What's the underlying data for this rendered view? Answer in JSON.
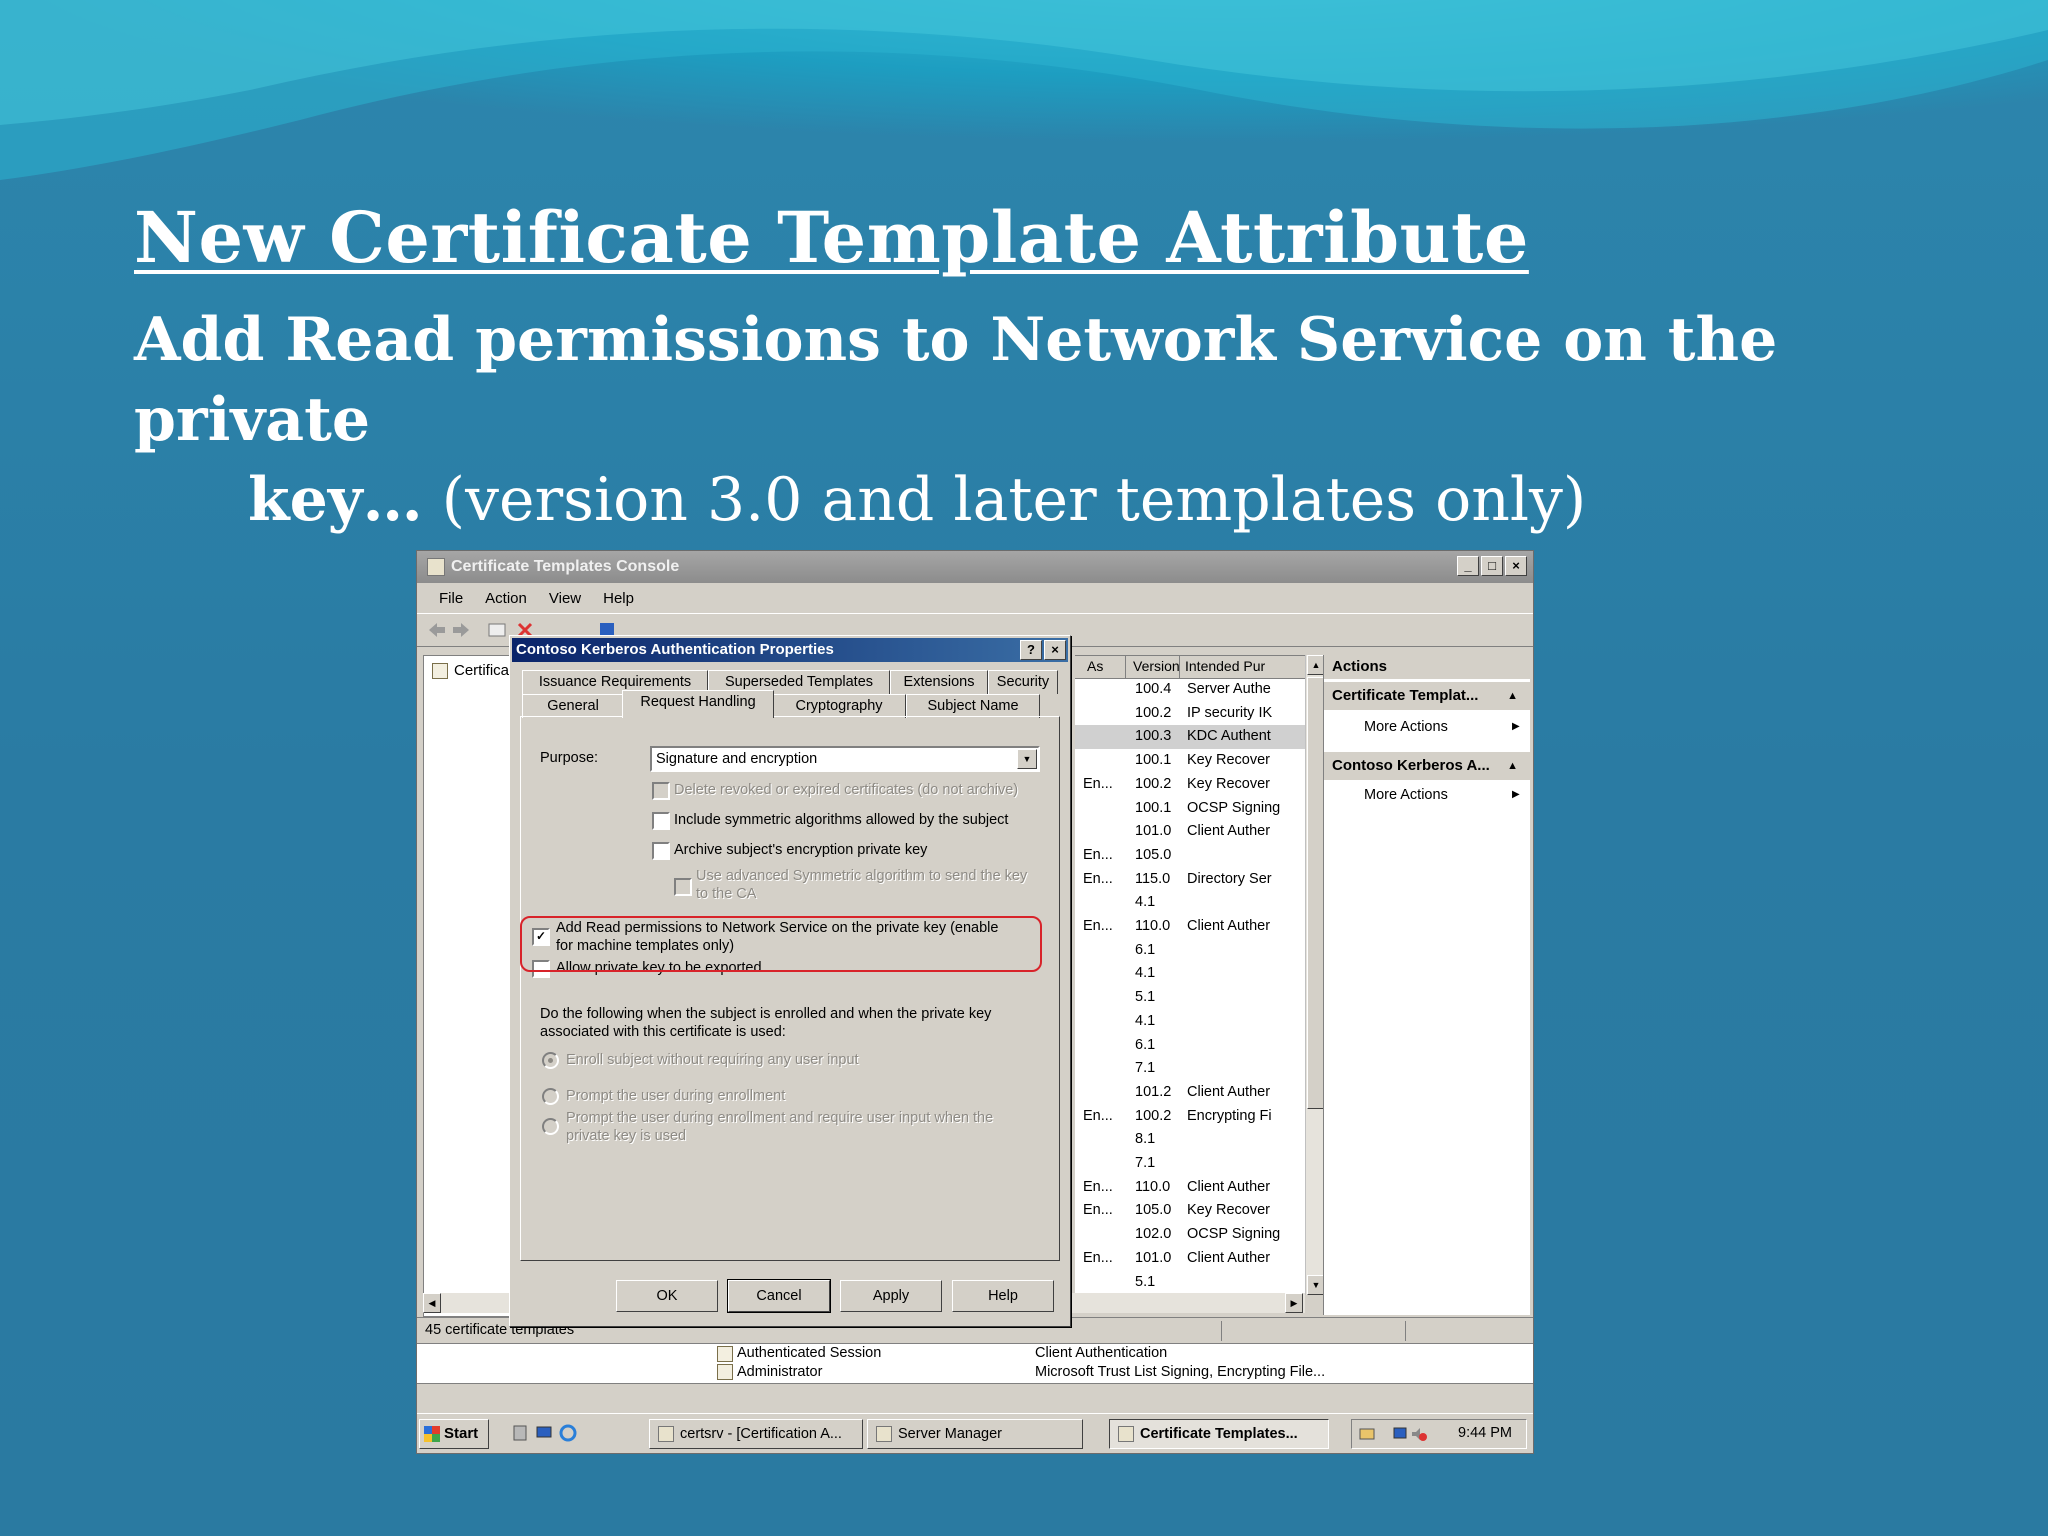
{
  "slide": {
    "title": "New Certificate Template Attribute",
    "subtitle_bold_1": "Add Read permissions to Network Service on the private",
    "subtitle_bold_2": "key…",
    "subtitle_normal": " (version 3.0 and later templates only)"
  },
  "window": {
    "title": "Certificate Templates Console",
    "menu": [
      "File",
      "Action",
      "View",
      "Help"
    ],
    "tree_item": "Certifica"
  },
  "list": {
    "columns": [
      "As",
      "Version",
      "Intended Pur"
    ],
    "rows": [
      {
        "as": "",
        "version": "100.4",
        "purpose": "Server Authe"
      },
      {
        "as": "",
        "version": "100.2",
        "purpose": "IP security IK"
      },
      {
        "as": "",
        "version": "100.3",
        "purpose": "KDC Authent"
      },
      {
        "as": "",
        "version": "100.1",
        "purpose": "Key Recover"
      },
      {
        "as": "En...",
        "version": "100.2",
        "purpose": "Key Recover"
      },
      {
        "as": "",
        "version": "100.1",
        "purpose": "OCSP Signing"
      },
      {
        "as": "",
        "version": "101.0",
        "purpose": "Client Auther"
      },
      {
        "as": "En...",
        "version": "105.0",
        "purpose": ""
      },
      {
        "as": "En...",
        "version": "115.0",
        "purpose": "Directory Ser"
      },
      {
        "as": "",
        "version": "4.1",
        "purpose": ""
      },
      {
        "as": "En...",
        "version": "110.0",
        "purpose": "Client Auther"
      },
      {
        "as": "",
        "version": "6.1",
        "purpose": ""
      },
      {
        "as": "",
        "version": "4.1",
        "purpose": ""
      },
      {
        "as": "",
        "version": "5.1",
        "purpose": ""
      },
      {
        "as": "",
        "version": "4.1",
        "purpose": ""
      },
      {
        "as": "",
        "version": "6.1",
        "purpose": ""
      },
      {
        "as": "",
        "version": "7.1",
        "purpose": ""
      },
      {
        "as": "",
        "version": "101.2",
        "purpose": "Client Auther"
      },
      {
        "as": "En...",
        "version": "100.2",
        "purpose": "Encrypting Fi"
      },
      {
        "as": "",
        "version": "8.1",
        "purpose": ""
      },
      {
        "as": "",
        "version": "7.1",
        "purpose": ""
      },
      {
        "as": "En...",
        "version": "110.0",
        "purpose": "Client Auther"
      },
      {
        "as": "En...",
        "version": "105.0",
        "purpose": "Key Recover"
      },
      {
        "as": "",
        "version": "102.0",
        "purpose": "OCSP Signing"
      },
      {
        "as": "En...",
        "version": "101.0",
        "purpose": "Client Auther"
      },
      {
        "as": "",
        "version": "5.1",
        "purpose": ""
      }
    ],
    "selected_index": 2
  },
  "actions": {
    "header": "Actions",
    "group1": "Certificate Templat...",
    "group1_item": "More Actions",
    "group2": "Contoso Kerberos A...",
    "group2_item": "More Actions"
  },
  "status": {
    "text": "45 certificate templates"
  },
  "bottom_list": {
    "row1_name": "Authenticated Session",
    "row1_purpose": "Client Authentication",
    "row2_name": "Administrator",
    "row2_purpose": "Microsoft Trust List Signing, Encrypting File..."
  },
  "taskbar": {
    "start": "Start",
    "task1": "certsrv - [Certification A...",
    "task2": "Server Manager",
    "task3": "Certificate Templates...",
    "clock": "9:44 PM"
  },
  "dialog": {
    "title": "Contoso Kerberos Authentication Properties",
    "tabs_row1": [
      "Issuance Requirements",
      "Superseded Templates",
      "Extensions",
      "Security"
    ],
    "tabs_row2": [
      "General",
      "Request Handling",
      "Cryptography",
      "Subject Name"
    ],
    "active_tab": "Request Handling",
    "purpose_label": "Purpose:",
    "purpose_value": "Signature and encryption",
    "opt_delete_revoked": "Delete revoked or expired certificates (do not archive)",
    "opt_symmetric": "Include symmetric algorithms allowed by the subject",
    "opt_archive": "Archive subject's encryption private key",
    "opt_advanced_1": "Use advanced Symmetric algorithm to send the key",
    "opt_advanced_2": "to the CA",
    "opt_read_perm_1": "Add Read permissions to Network Service on the private key (enable",
    "opt_read_perm_2": "for machine templates only)",
    "opt_export": "Allow private key to be exported",
    "enroll_desc_1": "Do the following when the subject is enrolled and when the private key",
    "enroll_desc_2": "associated with this certificate is used:",
    "radio_enroll": "Enroll subject without requiring any user input",
    "radio_prompt": "Prompt the user during enrollment",
    "radio_prompt_req_1": "Prompt the user during enrollment and require user input when the",
    "radio_prompt_req_2": "private key is used",
    "btn_ok": "OK",
    "btn_cancel": "Cancel",
    "btn_apply": "Apply",
    "btn_help": "Help"
  },
  "colors": {
    "highlight_box": "#d8232a",
    "dialog_title": "#0a246a"
  }
}
